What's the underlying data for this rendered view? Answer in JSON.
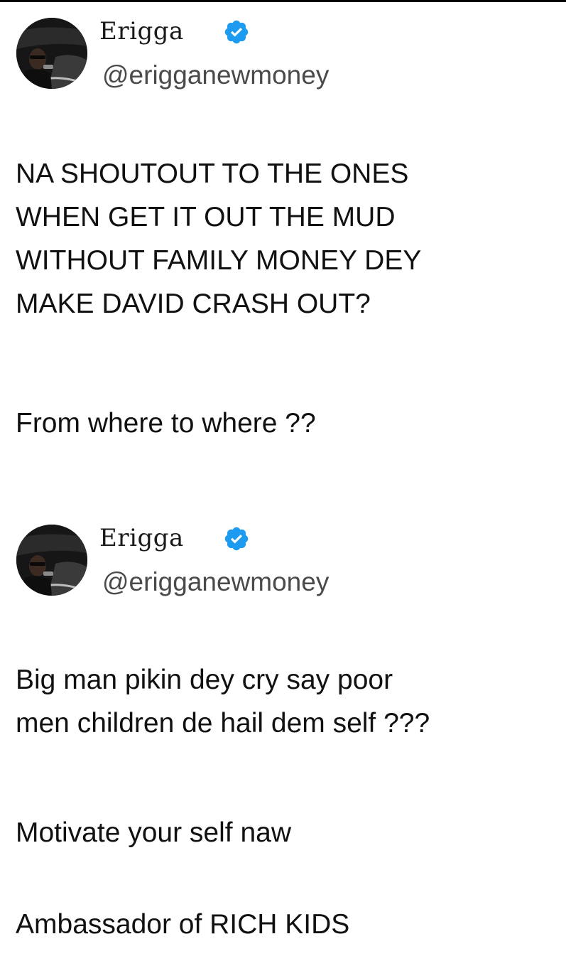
{
  "colors": {
    "verified_badge": "#1d9bf0",
    "text": "#111111",
    "handle": "#4a4a4a"
  },
  "tweets": [
    {
      "display_name": "Erigga",
      "handle": "@erigganewmoney",
      "verified_icon": "verified-badge-icon",
      "text": "NA SHOUTOUT TO THE ONES\nWHEN GET IT OUT THE MUD\nWITHOUT FAMILY MONEY DEY\nMAKE DAVID CRASH OUT?",
      "text_2": "From where to where ??"
    },
    {
      "display_name": "Erigga",
      "handle": "@erigganewmoney",
      "verified_icon": "verified-badge-icon",
      "text": "Big man pikin dey cry say poor\nmen children de hail dem self ???",
      "text_2": "Motivate your self naw",
      "text_3": "Ambassador of RICH KIDS"
    }
  ]
}
